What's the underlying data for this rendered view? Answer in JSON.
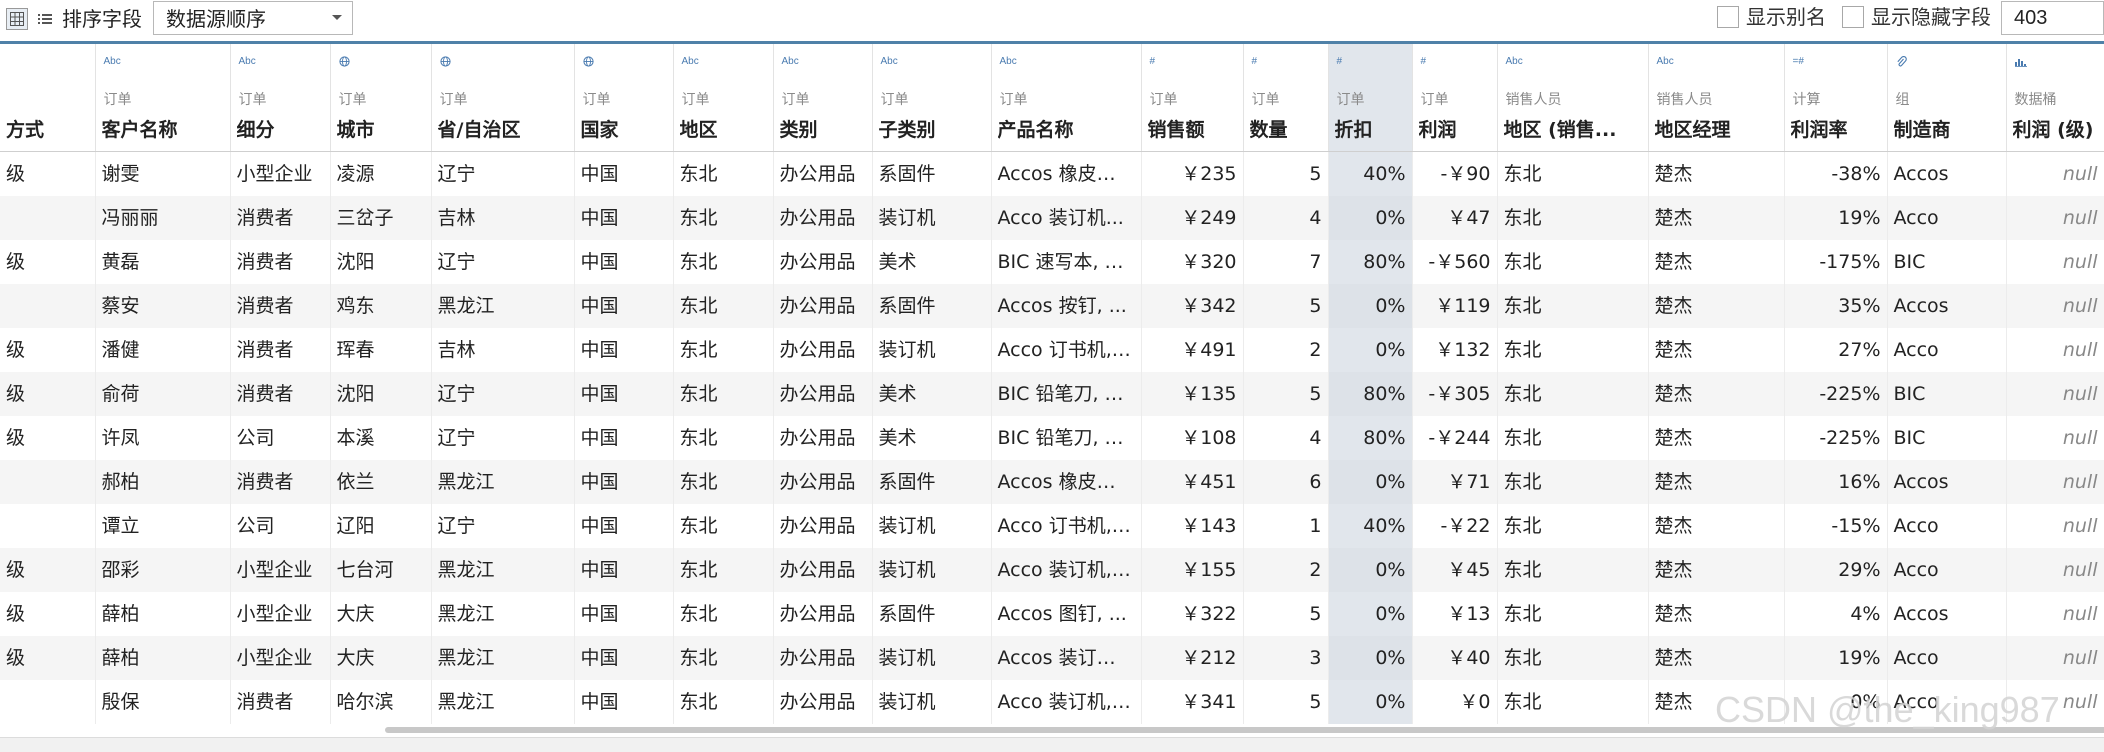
{
  "toolbar": {
    "sort_label": "排序字段",
    "sort_value": "数据源顺序",
    "show_alias_label": "显示别名",
    "show_hidden_label": "显示隐藏字段",
    "row_count": "403"
  },
  "colors": {
    "accent": "#4f81a8",
    "selected_column": "#e1e6ec",
    "type_icon": "#4a7bb0"
  },
  "columns": [
    {
      "icon": "",
      "source": "",
      "name": "方式",
      "type": "text"
    },
    {
      "icon": "Abc",
      "source": "订单",
      "name": "客户名称",
      "type": "text"
    },
    {
      "icon": "Abc",
      "source": "订单",
      "name": "细分",
      "type": "text"
    },
    {
      "icon": "globe",
      "source": "订单",
      "name": "城市",
      "type": "text"
    },
    {
      "icon": "globe",
      "source": "订单",
      "name": "省/自治区",
      "type": "text"
    },
    {
      "icon": "globe",
      "source": "订单",
      "name": "国家",
      "type": "text"
    },
    {
      "icon": "Abc",
      "source": "订单",
      "name": "地区",
      "type": "text"
    },
    {
      "icon": "Abc",
      "source": "订单",
      "name": "类别",
      "type": "text"
    },
    {
      "icon": "Abc",
      "source": "订单",
      "name": "子类别",
      "type": "text"
    },
    {
      "icon": "Abc",
      "source": "订单",
      "name": "产品名称",
      "type": "text"
    },
    {
      "icon": "#",
      "source": "订单",
      "name": "销售额",
      "type": "num"
    },
    {
      "icon": "#",
      "source": "订单",
      "name": "数量",
      "type": "num"
    },
    {
      "icon": "#",
      "source": "订单",
      "name": "折扣",
      "type": "num"
    },
    {
      "icon": "#",
      "source": "订单",
      "name": "利润",
      "type": "num"
    },
    {
      "icon": "Abc",
      "source": "销售人员",
      "name": "地区 (销售...",
      "type": "text"
    },
    {
      "icon": "Abc",
      "source": "销售人员",
      "name": "地区经理",
      "type": "text"
    },
    {
      "icon": "=#",
      "source": "计算",
      "name": "利润率",
      "type": "num"
    },
    {
      "icon": "clip",
      "source": "组",
      "name": "制造商",
      "type": "text"
    },
    {
      "icon": "bins",
      "source": "数据桶",
      "name": "利润 (级)",
      "type": "null"
    }
  ],
  "rows": [
    [
      "级",
      "谢雯",
      "小型企业",
      "凌源",
      "辽宁",
      "中国",
      "东北",
      "办公用品",
      "系固件",
      "Accos 橡皮筋,...",
      "￥235",
      "5",
      "40%",
      "-￥90",
      "东北",
      "楚杰",
      "-38%",
      "Accos",
      "null"
    ],
    [
      "",
      "冯丽丽",
      "消费者",
      "三岔子",
      "吉林",
      "中国",
      "东北",
      "办公用品",
      "装订机",
      "Acco 装订机...",
      "￥249",
      "4",
      "0%",
      "￥47",
      "东北",
      "楚杰",
      "19%",
      "Acco",
      "null"
    ],
    [
      "级",
      "黄磊",
      "消费者",
      "沈阳",
      "辽宁",
      "中国",
      "东北",
      "办公用品",
      "美术",
      "BIC 速写本, 整包",
      "￥320",
      "7",
      "80%",
      "-￥560",
      "东北",
      "楚杰",
      "-175%",
      "BIC",
      "null"
    ],
    [
      "",
      "蔡安",
      "消费者",
      "鸡东",
      "黑龙江",
      "中国",
      "东北",
      "办公用品",
      "系固件",
      "Accos 按钉, ...",
      "￥342",
      "5",
      "0%",
      "￥119",
      "东北",
      "楚杰",
      "35%",
      "Accos",
      "null"
    ],
    [
      "级",
      "潘健",
      "消费者",
      "珲春",
      "吉林",
      "中国",
      "东北",
      "办公用品",
      "装订机",
      "Acco 订书机, ...",
      "￥491",
      "2",
      "0%",
      "￥132",
      "东北",
      "楚杰",
      "27%",
      "Acco",
      "null"
    ],
    [
      "级",
      "俞荷",
      "消费者",
      "沈阳",
      "辽宁",
      "中国",
      "东北",
      "办公用品",
      "美术",
      "BIC 铅笔刀, 蓝色",
      "￥135",
      "5",
      "80%",
      "-￥305",
      "东北",
      "楚杰",
      "-225%",
      "BIC",
      "null"
    ],
    [
      "级",
      "许凤",
      "公司",
      "本溪",
      "辽宁",
      "中国",
      "东北",
      "办公用品",
      "美术",
      "BIC 铅笔刀, 蓝色",
      "￥108",
      "4",
      "80%",
      "-￥244",
      "东北",
      "楚杰",
      "-225%",
      "BIC",
      "null"
    ],
    [
      "",
      "郝柏",
      "消费者",
      "依兰",
      "黑龙江",
      "中国",
      "东北",
      "办公用品",
      "系固件",
      "Accos 橡皮筋,...",
      "￥451",
      "6",
      "0%",
      "￥71",
      "东北",
      "楚杰",
      "16%",
      "Accos",
      "null"
    ],
    [
      "",
      "谭立",
      "公司",
      "辽阳",
      "辽宁",
      "中国",
      "东北",
      "办公用品",
      "装订机",
      "Acco 订书机, ...",
      "￥143",
      "1",
      "40%",
      "-￥22",
      "东北",
      "楚杰",
      "-15%",
      "Acco",
      "null"
    ],
    [
      "级",
      "邵彩",
      "小型企业",
      "七台河",
      "黑龙江",
      "中国",
      "东北",
      "办公用品",
      "装订机",
      "Acco 装订机, ...",
      "￥155",
      "2",
      "0%",
      "￥45",
      "东北",
      "楚杰",
      "29%",
      "Acco",
      "null"
    ],
    [
      "级",
      "薛柏",
      "小型企业",
      "大庆",
      "黑龙江",
      "中国",
      "东北",
      "办公用品",
      "系固件",
      "Accos 图钉, ...",
      "￥322",
      "5",
      "0%",
      "￥13",
      "东北",
      "楚杰",
      "4%",
      "Accos",
      "null"
    ],
    [
      "级",
      "薛柏",
      "小型企业",
      "大庆",
      "黑龙江",
      "中国",
      "东北",
      "办公用品",
      "装订机",
      "Accos 装订机, ...",
      "￥212",
      "3",
      "0%",
      "￥40",
      "东北",
      "楚杰",
      "19%",
      "Acco",
      "null"
    ],
    [
      "",
      "殷保",
      "消费者",
      "哈尔滨",
      "黑龙江",
      "中国",
      "东北",
      "办公用品",
      "装订机",
      "Acco 装订机, ...",
      "￥341",
      "5",
      "0%",
      "￥0",
      "东北",
      "楚杰",
      "0%",
      "Acco",
      "null"
    ]
  ],
  "watermark": "CSDN @the_king987"
}
